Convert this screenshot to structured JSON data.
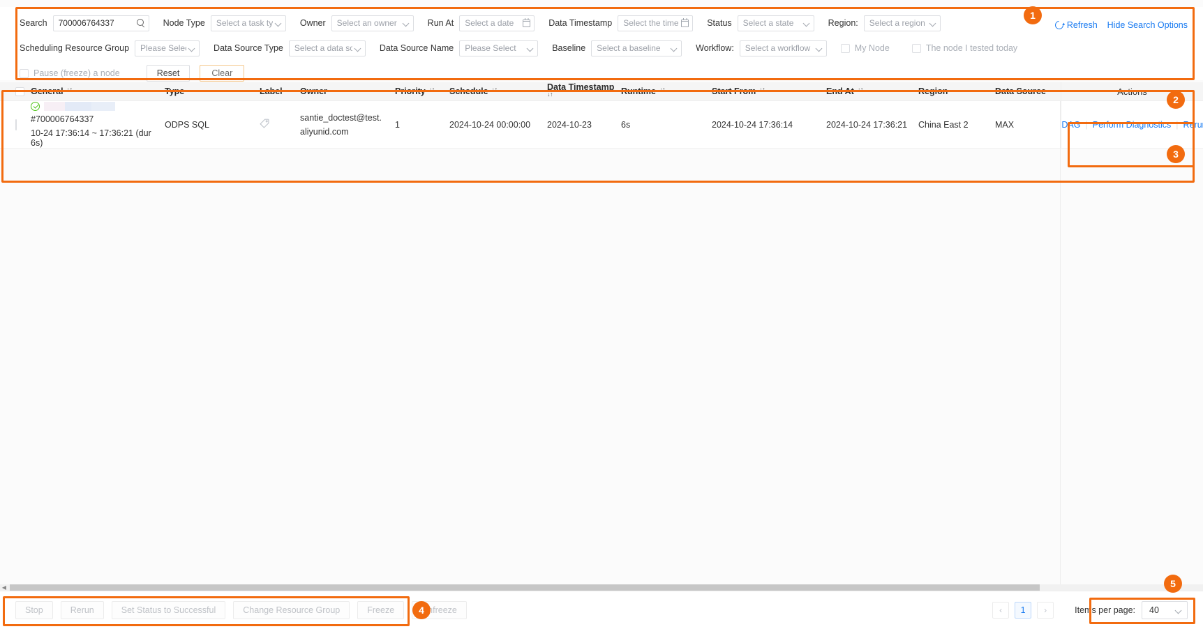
{
  "search": {
    "fields": {
      "search_label": "Search",
      "search_value": "700006764337",
      "node_type_label": "Node Type",
      "node_type_placeholder": "Select a task type",
      "owner_label": "Owner",
      "owner_placeholder": "Select an owner",
      "run_at_label": "Run At",
      "run_at_placeholder": "Select a date",
      "data_timestamp_label": "Data Timestamp",
      "data_timestamp_placeholder": "Select the timestamp",
      "status_label": "Status",
      "status_placeholder": "Select a state",
      "region_label": "Region:",
      "region_placeholder": "Select a region",
      "srg_label": "Scheduling Resource Group",
      "srg_placeholder": "Please Select",
      "dst_label": "Data Source Type",
      "dst_placeholder": "Select a data source",
      "dsn_label": "Data Source Name",
      "dsn_placeholder": "Please Select",
      "baseline_label": "Baseline",
      "baseline_placeholder": "Select a baseline",
      "workflow_label": "Workflow:",
      "workflow_placeholder": "Select a workflow",
      "my_node_label": "My Node",
      "tested_today_label": "The node I tested today",
      "pause_label": "Pause (freeze) a node",
      "reset_label": "Reset",
      "clear_label": "Clear"
    },
    "links": {
      "refresh": "Refresh",
      "hide_options": "Hide Search Options"
    }
  },
  "table": {
    "columns": [
      "General",
      "Type",
      "Label",
      "Owner",
      "Priority",
      "Schedule",
      "Data Timestamp",
      "Runtime",
      "Start From",
      "End At",
      "Region",
      "Data Source",
      "Actions"
    ],
    "rows": [
      {
        "status": "success",
        "name_redacted": "",
        "id": "#700006764337",
        "duration": "10-24 17:36:14 ~ 17:36:21 (dur 6s)",
        "type": "ODPS SQL",
        "label": "",
        "owner": "santie_doctest@test.aliyunid.com",
        "priority": "1",
        "schedule": "2024-10-24 00:00:00",
        "data_timestamp": "2024-10-23",
        "runtime": "6s",
        "start_from": "2024-10-24 17:36:14",
        "end_at": "2024-10-24 17:36:21",
        "region": "China East 2",
        "data_source": "MAX",
        "actions": [
          "DAG",
          "Perform Diagnostics",
          "Rerun"
        ]
      }
    ]
  },
  "footer": {
    "buttons": [
      "Stop",
      "Rerun",
      "Set Status to Successful",
      "Change Resource Group",
      "Freeze",
      "Unfreeze"
    ],
    "pagination": {
      "prev": "‹",
      "current_page": "1",
      "next": "›",
      "items_per_page_label": "Items per page:",
      "items_per_page_value": "40"
    }
  },
  "annotations": [
    {
      "number": "1"
    },
    {
      "number": "2"
    },
    {
      "number": "3"
    },
    {
      "number": "4"
    },
    {
      "number": "5"
    }
  ],
  "colors": {
    "accent": "#f26b0f",
    "link": "#187af1",
    "success": "#52c41a"
  }
}
